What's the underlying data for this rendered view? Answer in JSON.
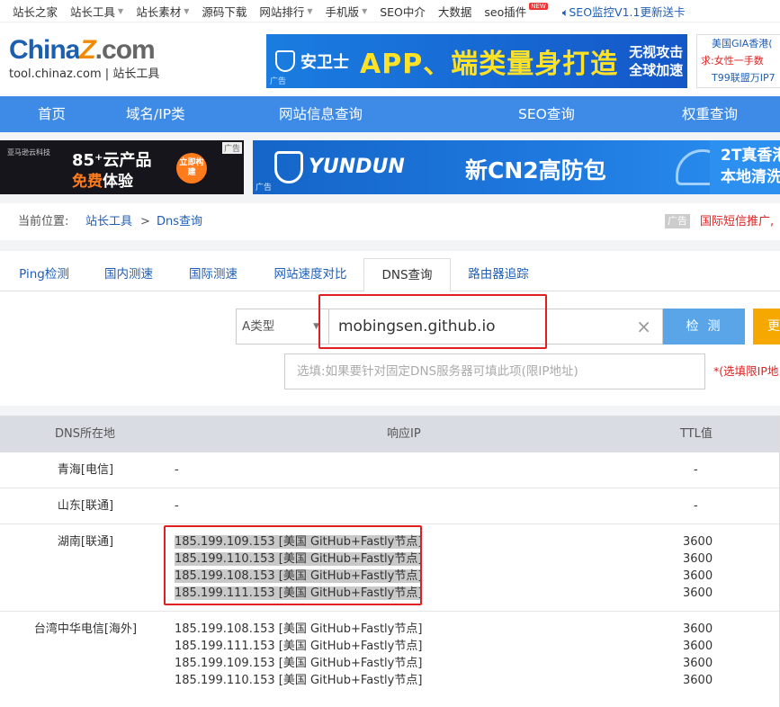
{
  "topbar": {
    "items": [
      {
        "label": "站长之家",
        "dropdown": false
      },
      {
        "label": "站长工具",
        "dropdown": true
      },
      {
        "label": "站长素材",
        "dropdown": true
      },
      {
        "label": "源码下载",
        "dropdown": false
      },
      {
        "label": "网站排行",
        "dropdown": true
      },
      {
        "label": "手机版",
        "dropdown": true
      },
      {
        "label": "SEO中介",
        "dropdown": false
      },
      {
        "label": "大数据",
        "dropdown": false
      },
      {
        "label": "seo插件",
        "dropdown": false
      }
    ],
    "new_badge": "NEW",
    "monitor_text": "SEO监控V1.1更新送卡"
  },
  "header": {
    "logo_main": "China",
    "logo_z": "Z",
    "logo_com": ".com",
    "logo_sub": "tool.chinaz.com | 站长工具",
    "banner": {
      "brand": "安卫士",
      "headline": "APP、端类量身打造",
      "side_line1": "无视攻击",
      "side_line2": "全球加速",
      "ad_tag": "广告"
    },
    "side_ad": {
      "line1": "美国GIA香港(",
      "line2": "求:女性一手数",
      "line3": "T99联盟万IP7"
    }
  },
  "nav": {
    "items": [
      "首页",
      "域名/IP类",
      "网站信息查询",
      "SEO查询",
      "权重查询"
    ]
  },
  "ads": {
    "ad1": {
      "small": "亚马逊云科技",
      "line1": "85⁺云产品",
      "line2_free": "免费",
      "line2_rest": "体验",
      "btn": "立即构建",
      "tag": "广告"
    },
    "ad2": {
      "brand": "YUNDUN",
      "headline": "新CN2高防包",
      "right1": "2T真香港",
      "right2": "本地清洗",
      "tag": "广告"
    }
  },
  "breadcrumb": {
    "position_label": "当前位置:",
    "crumb1": "站长工具",
    "separator": ">",
    "crumb2": "Dns查询",
    "ad_tag": "广告",
    "promo": "国际短信推广,"
  },
  "tabs": [
    "Ping检测",
    "国内测速",
    "国际测速",
    "网站速度对比",
    "DNS查询",
    "路由器追踪"
  ],
  "form": {
    "record_type": "A类型",
    "domain_value": "mobingsen.github.io",
    "check_button": "检测",
    "more_button": "更",
    "dns_placeholder": "选填:如果要针对固定DNS服务器可填此项(限IP地址)",
    "hint": "*(选填限IP地"
  },
  "results": {
    "headers": {
      "location": "DNS所在地",
      "ip": "响应IP",
      "ttl": "TTL值"
    },
    "rows": [
      {
        "location": "青海[电信]",
        "ips": [
          "-"
        ],
        "ttls": [
          "-"
        ]
      },
      {
        "location": "山东[联通]",
        "ips": [
          "-"
        ],
        "ttls": [
          "-"
        ]
      },
      {
        "location": "湖南[联通]",
        "ips": [
          "185.199.109.153 [美国 GitHub+Fastly节点]",
          "185.199.110.153 [美国 GitHub+Fastly节点]",
          "185.199.108.153 [美国 GitHub+Fastly节点]",
          "185.199.111.153 [美国 GitHub+Fastly节点]"
        ],
        "ttls": [
          "3600",
          "3600",
          "3600",
          "3600"
        ]
      },
      {
        "location": "台湾中华电信[海外]",
        "ips": [
          "185.199.108.153 [美国 GitHub+Fastly节点]",
          "185.199.111.153 [美国 GitHub+Fastly节点]",
          "185.199.109.153 [美国 GitHub+Fastly节点]",
          "185.199.110.153 [美国 GitHub+Fastly节点]"
        ],
        "ttls": [
          "3600",
          "3600",
          "3600",
          "3600"
        ]
      }
    ]
  }
}
